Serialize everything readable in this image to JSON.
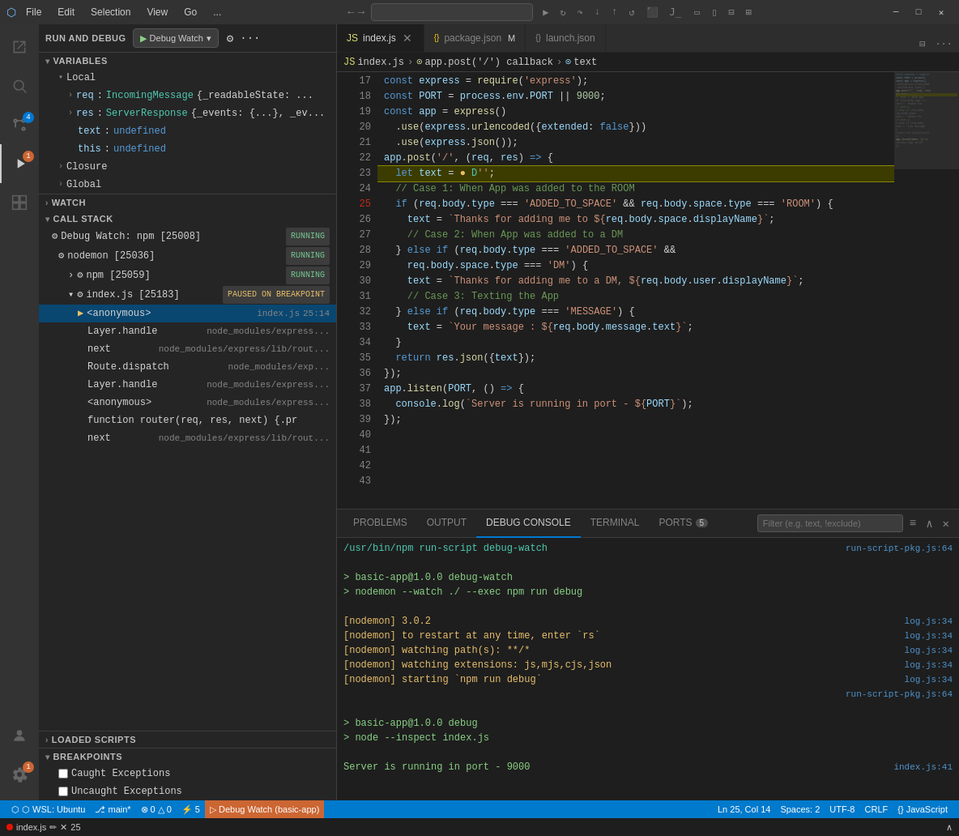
{
  "titleBar": {
    "menus": [
      "File",
      "Edit",
      "Selection",
      "View",
      "Go",
      "..."
    ],
    "searchPlaceholder": "",
    "windowControls": [
      "─",
      "□",
      "✕"
    ]
  },
  "activityBar": {
    "items": [
      {
        "name": "explorer",
        "icon": "⬜",
        "tooltip": "Explorer"
      },
      {
        "name": "search",
        "icon": "🔍",
        "tooltip": "Search"
      },
      {
        "name": "source-control",
        "icon": "⑂",
        "tooltip": "Source Control",
        "badge": "4"
      },
      {
        "name": "run-debug",
        "icon": "▷",
        "tooltip": "Run and Debug",
        "active": true,
        "badge": "1"
      },
      {
        "name": "extensions",
        "icon": "⊞",
        "tooltip": "Extensions"
      }
    ],
    "bottom": [
      {
        "name": "accounts",
        "icon": "👤"
      },
      {
        "name": "settings",
        "icon": "⚙",
        "badgeWarn": "1"
      }
    ]
  },
  "sidebar": {
    "title": "RUN AND DEBUG",
    "debugConfig": "Debug Watch",
    "variables": {
      "title": "VARIABLES",
      "sections": [
        {
          "name": "Local",
          "items": [
            {
              "name": "req",
              "type": "IncomingMessage",
              "value": "{_readableState: ...",
              "indent": 2
            },
            {
              "name": "res",
              "type": "ServerResponse",
              "value": "{_events: {...}, _ev...",
              "indent": 2
            },
            {
              "name": "text",
              "value": "undefined",
              "indent": 3
            },
            {
              "name": "this",
              "value": "undefined",
              "indent": 3
            }
          ]
        },
        {
          "name": "Closure"
        },
        {
          "name": "Global"
        }
      ]
    },
    "watch": {
      "title": "WATCH"
    },
    "callStack": {
      "title": "CALL STACK",
      "items": [
        {
          "name": "Debug Watch: npm [25008]",
          "status": "RUNNING",
          "indent": 0
        },
        {
          "name": "nodemon [25036]",
          "status": "RUNNING",
          "indent": 1
        },
        {
          "name": "npm [25059]",
          "status": "RUNNING",
          "indent": 2
        },
        {
          "name": "index.js [25183]",
          "status": "PAUSED ON BREAKPOINT",
          "indent": 2
        },
        {
          "name": "<anonymous>",
          "file": "index.js",
          "line": "25:14",
          "indent": 3,
          "active": true
        },
        {
          "name": "Layer.handle",
          "file": "node_modules/express...",
          "indent": 4
        },
        {
          "name": "next",
          "file": "node_modules/express/lib/rout...",
          "indent": 4
        },
        {
          "name": "Route.dispatch",
          "file": "node_modules/exp...",
          "indent": 4
        },
        {
          "name": "Layer.handle",
          "file": "node_modules/express...",
          "indent": 4
        },
        {
          "name": "<anonymous>",
          "file": "node_modules/express...",
          "indent": 4
        },
        {
          "name": "function router(req, res, next) {.pr",
          "indent": 4
        },
        {
          "name": "next",
          "file": "node_modules/express/lib/rout...",
          "indent": 4
        }
      ]
    },
    "loadedScripts": {
      "title": "LOADED SCRIPTS"
    },
    "breakpoints": {
      "title": "BREAKPOINTS",
      "items": [
        {
          "name": "Caught Exceptions",
          "checked": false
        },
        {
          "name": "Uncaught Exceptions",
          "checked": false
        }
      ]
    }
  },
  "tabs": [
    {
      "name": "index.js",
      "type": "js",
      "active": true,
      "modified": false
    },
    {
      "name": "package.json",
      "type": "json",
      "active": false,
      "modified": true
    },
    {
      "name": "launch.json",
      "type": "json",
      "active": false,
      "modified": false
    }
  ],
  "breadcrumb": {
    "items": [
      "index.js",
      "app.post('/') callback",
      "text"
    ]
  },
  "code": {
    "lines": [
      {
        "num": 17,
        "content": "const express = require('express');"
      },
      {
        "num": 18,
        "content": "const PORT = process.env.PORT || 9000;"
      },
      {
        "num": 19,
        "content": ""
      },
      {
        "num": 20,
        "content": "const app = express()"
      },
      {
        "num": 21,
        "content": "  .use(express.urlencoded({extended: false}))"
      },
      {
        "num": 22,
        "content": "  .use(express.json());"
      },
      {
        "num": 23,
        "content": ""
      },
      {
        "num": 24,
        "content": "app.post('/', (req, res) => {"
      },
      {
        "num": 25,
        "content": "  let text = ● D'';",
        "breakpoint": true,
        "current": true
      },
      {
        "num": 26,
        "content": "  // Case 1: When App was added to the ROOM"
      },
      {
        "num": 27,
        "content": "  if (req.body.type === 'ADDED_TO_SPACE' && req.body.space.type === 'ROOM') {"
      },
      {
        "num": 28,
        "content": "    text = `Thanks for adding me to ${req.body.space.displayName}`;"
      },
      {
        "num": 29,
        "content": "    // Case 2: When App was added to a DM"
      },
      {
        "num": 30,
        "content": "  } else if (req.body.type === 'ADDED_TO_SPACE' &&"
      },
      {
        "num": 31,
        "content": "    req.body.space.type === 'DM') {"
      },
      {
        "num": 32,
        "content": "    text = `Thanks for adding me to a DM, ${req.body.user.displayName}`;"
      },
      {
        "num": 33,
        "content": "    // Case 3: Texting the App"
      },
      {
        "num": 34,
        "content": "  } else if (req.body.type === 'MESSAGE') {"
      },
      {
        "num": 35,
        "content": "    text = `Your message : ${req.body.message.text}`;"
      },
      {
        "num": 36,
        "content": "  }"
      },
      {
        "num": 37,
        "content": "  return res.json({text});"
      },
      {
        "num": 38,
        "content": "});"
      },
      {
        "num": 39,
        "content": ""
      },
      {
        "num": 40,
        "content": "app.listen(PORT, () => {"
      },
      {
        "num": 41,
        "content": "  console.log(`Server is running in port - ${PORT}`);"
      },
      {
        "num": 42,
        "content": "});"
      },
      {
        "num": 43,
        "content": ""
      }
    ]
  },
  "bottomPanel": {
    "tabs": [
      {
        "name": "PROBLEMS",
        "active": false
      },
      {
        "name": "OUTPUT",
        "active": false
      },
      {
        "name": "DEBUG CONSOLE",
        "active": true
      },
      {
        "name": "TERMINAL",
        "active": false
      },
      {
        "name": "PORTS",
        "active": false,
        "badge": "5"
      }
    ],
    "filterPlaceholder": "Filter (e.g. text, !exclude)",
    "console": [
      {
        "type": "cmd",
        "text": "/usr/bin/npm run-script debug-watch",
        "link": "run-script-pkg.js:64"
      },
      {
        "type": "output",
        "text": ""
      },
      {
        "type": "green",
        "text": "> basic-app@1.0.0 debug-watch"
      },
      {
        "type": "green",
        "text": "> nodemon --watch ./ --exec npm run debug"
      },
      {
        "type": "output",
        "text": ""
      },
      {
        "type": "yellow",
        "text": "[nodemon] 3.0.2",
        "link": "log.js:34"
      },
      {
        "type": "yellow",
        "text": "[nodemon] to restart at any time, enter `rs`",
        "link": "log.js:34"
      },
      {
        "type": "yellow",
        "text": "[nodemon] watching path(s): **/*",
        "link": "log.js:34"
      },
      {
        "type": "yellow",
        "text": "[nodemon] watching extensions: js,mjs,cjs,json",
        "link": "log.js:34"
      },
      {
        "type": "yellow",
        "text": "[nodemon] starting `npm run debug`",
        "link": "log.js:34"
      },
      {
        "type": "output",
        "text": "",
        "link": "run-script-pkg.js:64"
      },
      {
        "type": "output",
        "text": ""
      },
      {
        "type": "green",
        "text": "> basic-app@1.0.0 debug"
      },
      {
        "type": "green",
        "text": "> node --inspect index.js"
      },
      {
        "type": "output",
        "text": ""
      },
      {
        "type": "green",
        "text": "Server is running in port - 9000",
        "link": "index.js:41"
      }
    ]
  },
  "statusBar": {
    "left": [
      {
        "text": "⬡ WSL: Ubuntu",
        "icon": "wsl"
      },
      {
        "text": "⎇ main*"
      },
      {
        "text": "⊗ 0 △ 0"
      },
      {
        "text": "⚡ 5"
      },
      {
        "text": "▷ Debug Watch (basic-app)",
        "debug": true
      }
    ],
    "right": [
      {
        "text": "Ln 25, Col 14"
      },
      {
        "text": "Spaces: 2"
      },
      {
        "text": "UTF-8"
      },
      {
        "text": "CRLF"
      },
      {
        "text": "{} JavaScript"
      }
    ]
  }
}
